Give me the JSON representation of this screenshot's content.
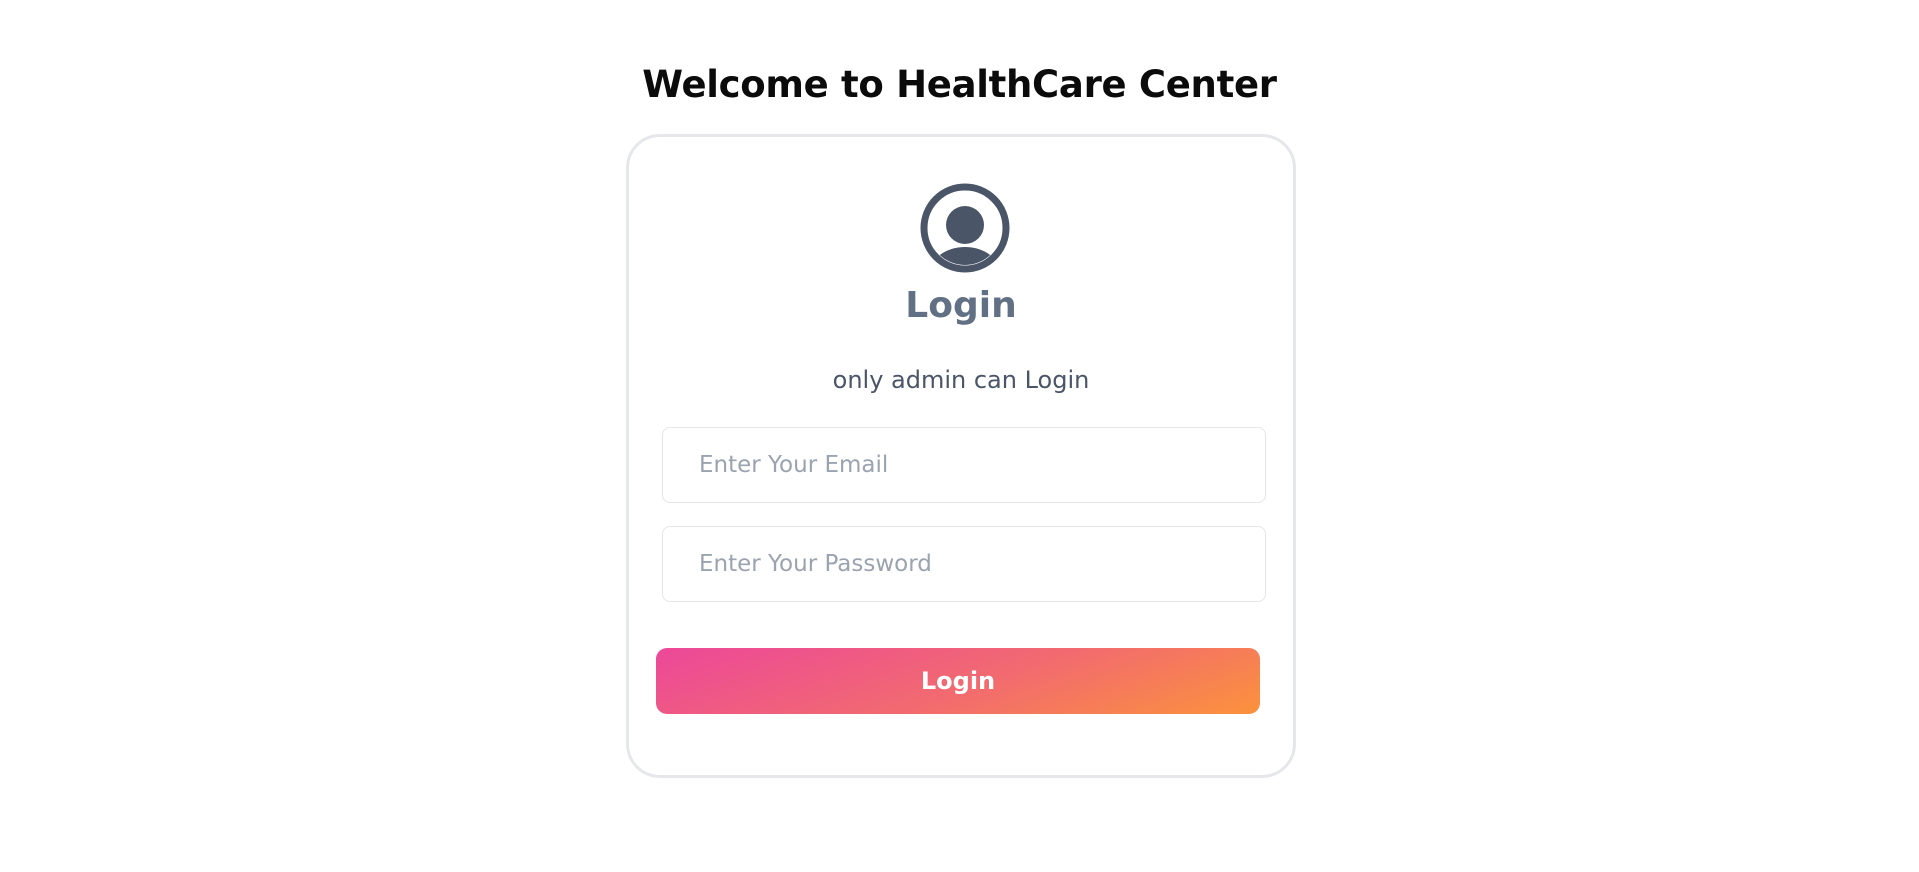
{
  "page": {
    "title": "Welcome to HealthCare Center"
  },
  "login_card": {
    "avatar_icon": "user-circle-icon",
    "heading": "Login",
    "subtitle": "only admin can Login",
    "email": {
      "value": "",
      "placeholder": "Enter Your Email"
    },
    "password": {
      "value": "",
      "placeholder": "Enter Your Password"
    },
    "submit_label": "Login"
  },
  "colors": {
    "avatar": "#4a5568",
    "heading": "#627085",
    "gradient_start": "#ec4899",
    "gradient_end": "#fb923c"
  }
}
